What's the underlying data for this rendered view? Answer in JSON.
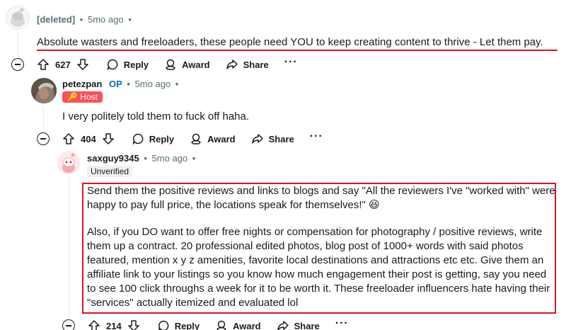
{
  "comment1": {
    "author": "[deleted]",
    "time": "5mo ago",
    "body": "Absolute wasters and freeloaders, these people need YOU to keep creating content to thrive - Let them pay.",
    "votes": "627",
    "actions": {
      "reply": "Reply",
      "award": "Award",
      "share": "Share",
      "more": "···"
    }
  },
  "comment2": {
    "author": "petezpan",
    "op_badge": "OP",
    "time": "5mo ago",
    "flair": "🔑 Host",
    "body": "I very politely told them to fuck off haha.",
    "votes": "404",
    "actions": {
      "reply": "Reply",
      "award": "Award",
      "share": "Share",
      "more": "···"
    }
  },
  "comment3": {
    "author": "saxguy9345",
    "time": "5mo ago",
    "flair": "Unverified",
    "body_p1": "Send them the positive reviews and links to blogs and say \"All the reviewers I've \"worked with\" were happy to pay full price, the locations speak for themselves!\" 😆",
    "body_p2": "Also, if you DO want to offer free nights or compensation for photography / positive reviews, write them up a contract. 20 professional edited photos, blog post of 1000+ words with said photos featured, mention x y z amenities, favorite local destinations and attractions etc etc. Give them an affiliate link to your listings so you know how much engagement their post is getting, say you need to see 100 click throughs a week for it to be worth it. These freeloader influencers hate having their \"services\" actually itemized and evaluated lol",
    "votes": "214",
    "actions": {
      "reply": "Reply",
      "award": "Award",
      "share": "Share",
      "more": "···"
    }
  },
  "colors": {
    "highlight": "#e0121f",
    "host_flair": "#ff4d5a",
    "op": "#0a66c2"
  }
}
